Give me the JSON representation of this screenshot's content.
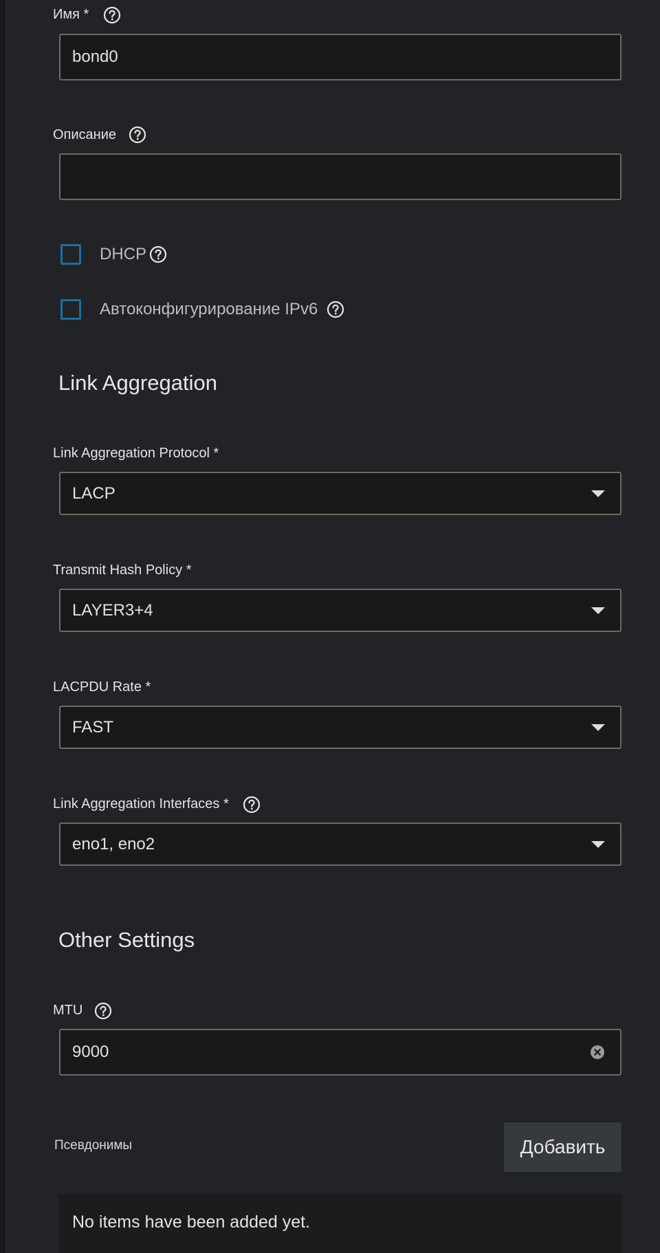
{
  "form": {
    "name": {
      "label": "Имя *",
      "value": "bond0"
    },
    "description": {
      "label": "Описание",
      "value": ""
    },
    "dhcp": {
      "label": "DHCP",
      "checked": false
    },
    "ipv6_auto": {
      "label": "Автоконфигурирование IPv6",
      "checked": false
    }
  },
  "link_aggregation": {
    "title": "Link Aggregation",
    "protocol": {
      "label": "Link Aggregation Protocol *",
      "value": "LACP"
    },
    "hash_policy": {
      "label": "Transmit Hash Policy *",
      "value": "LAYER3+4"
    },
    "lacpdu_rate": {
      "label": "LACPDU Rate *",
      "value": "FAST"
    },
    "interfaces": {
      "label": "Link Aggregation Interfaces *",
      "value": "eno1, eno2"
    }
  },
  "other_settings": {
    "title": "Other Settings",
    "mtu": {
      "label": "MTU",
      "value": "9000"
    },
    "aliases": {
      "label": "Псевдонимы",
      "add_label": "Добавить",
      "empty_text": "No items have been added yet."
    }
  },
  "colors": {
    "background": "#222326",
    "field_background": "#18191b",
    "field_border": "#6e6a60",
    "checkbox_border": "#1a6fa5",
    "button_background": "#363a3c"
  },
  "icons": {
    "help": "help-circle-icon",
    "dropdown": "caret-down-icon",
    "clear": "clear-circle-icon"
  }
}
